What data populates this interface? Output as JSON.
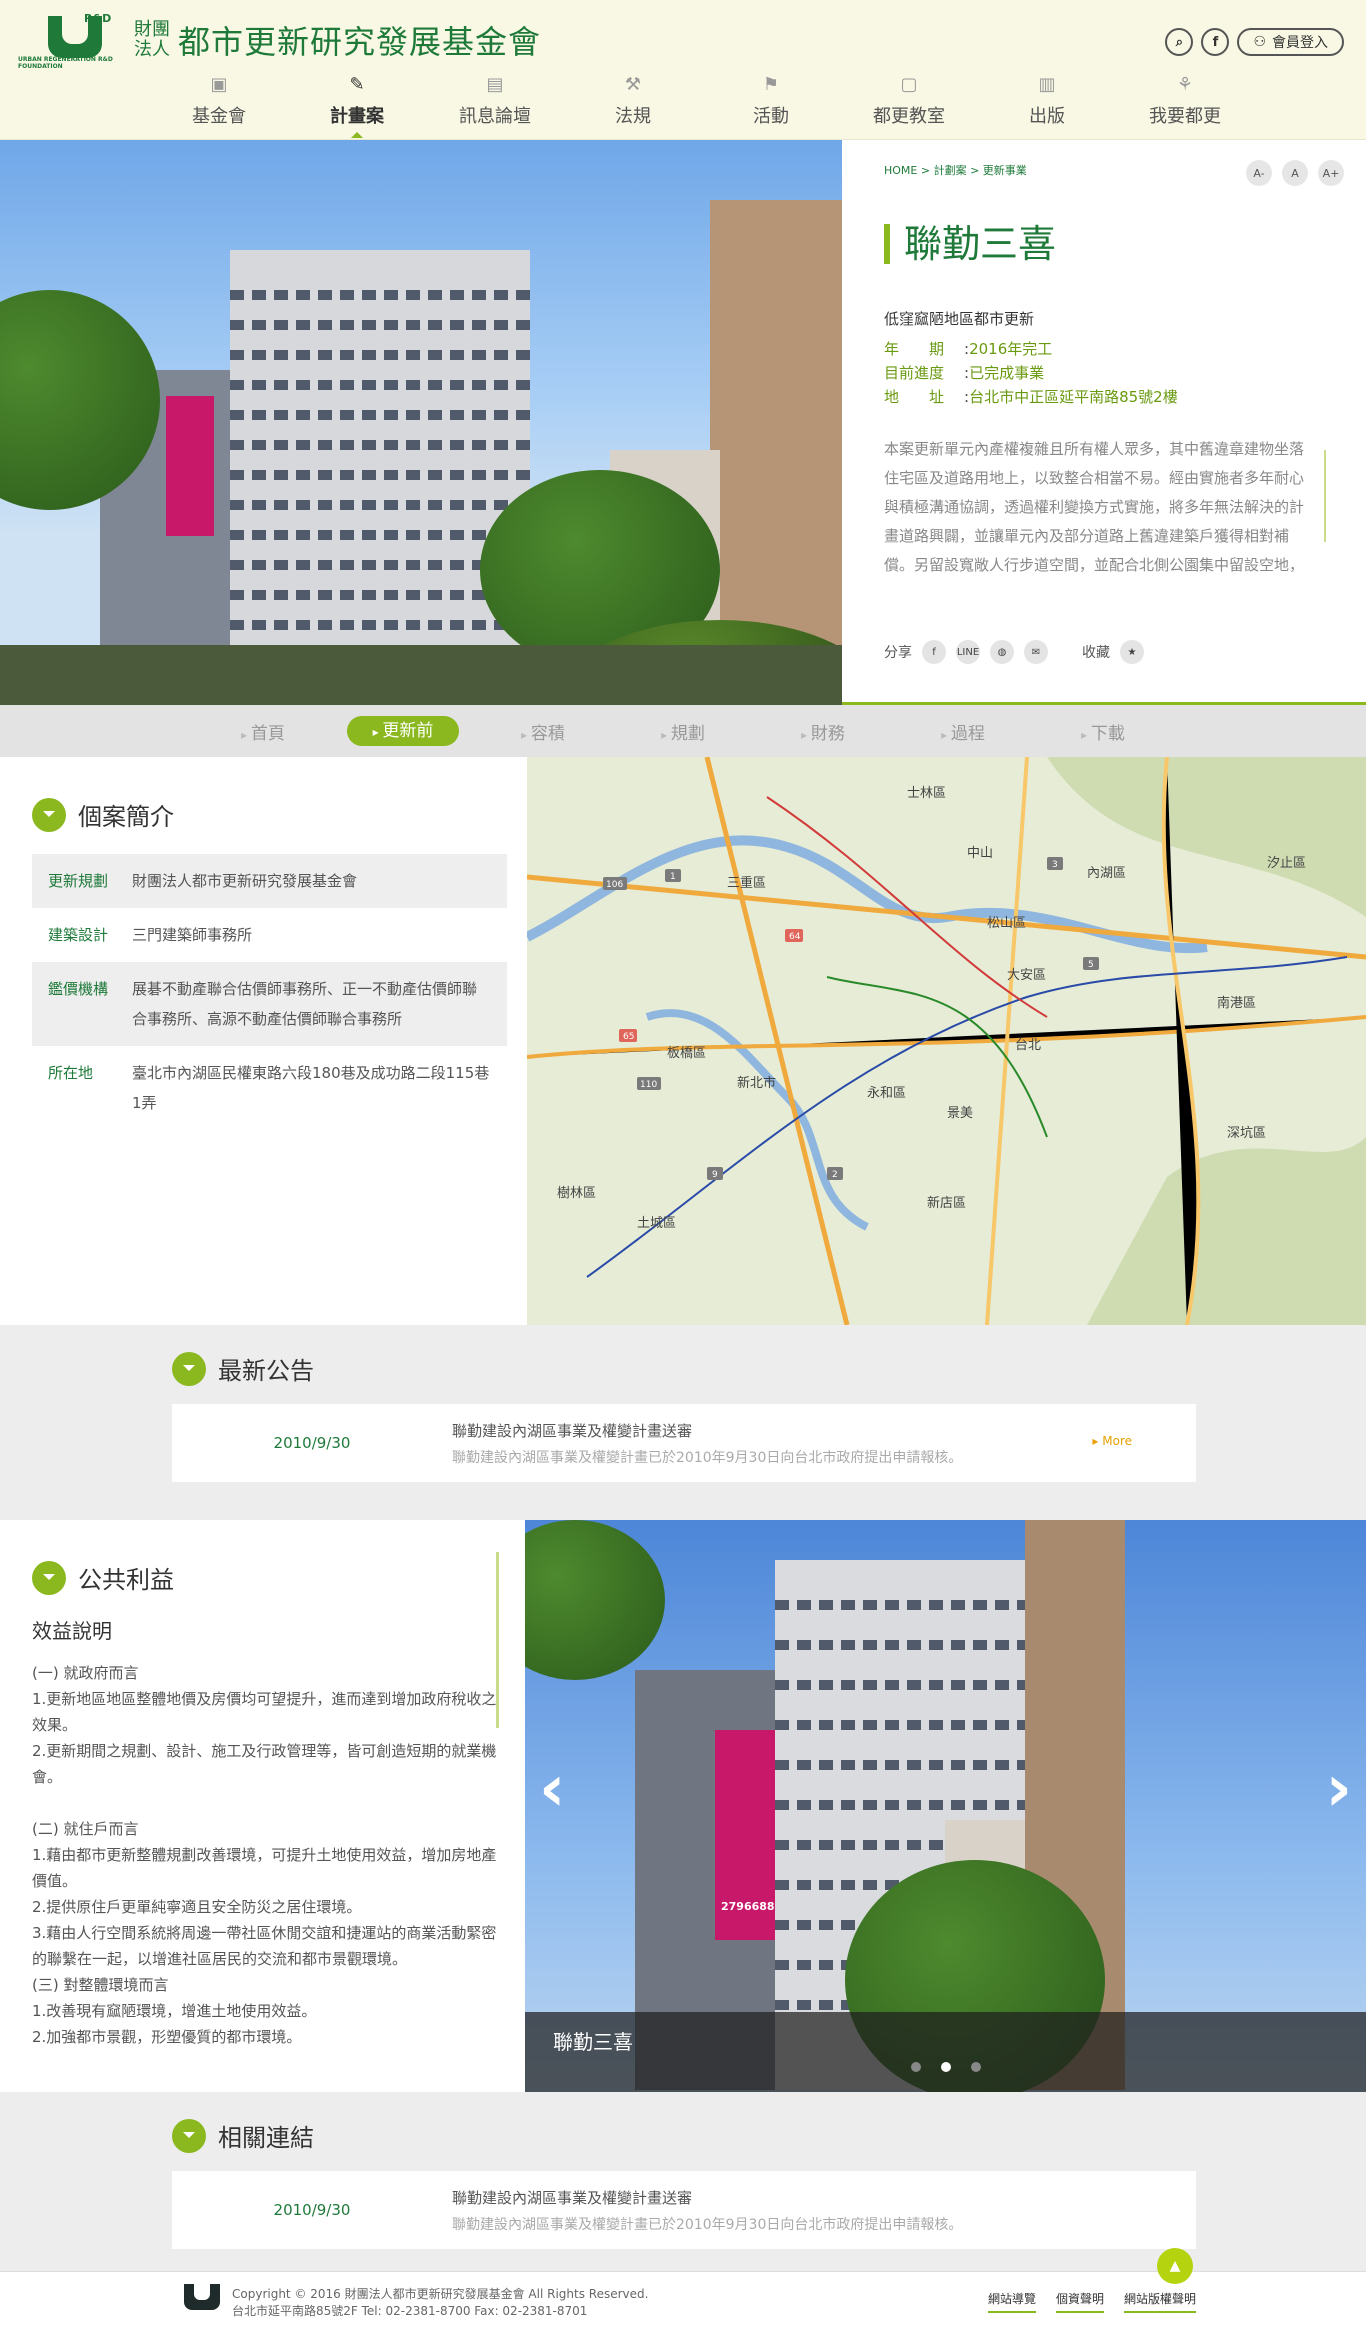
{
  "brand": {
    "small": "財團法人",
    "name": "都市更新研究發展基金會",
    "mark": "U R&D",
    "sub": "URBAN REGENERATION R&D FOUNDATION"
  },
  "tools": {
    "member_login": "會員登入"
  },
  "nav": [
    {
      "label": "基金會",
      "icon": "foundation-icon"
    },
    {
      "label": "計畫案",
      "icon": "project-icon"
    },
    {
      "label": "訊息論壇",
      "icon": "forum-icon"
    },
    {
      "label": "法規",
      "icon": "law-icon"
    },
    {
      "label": "活動",
      "icon": "event-icon"
    },
    {
      "label": "都更教室",
      "icon": "classroom-icon"
    },
    {
      "label": "出版",
      "icon": "publish-icon"
    },
    {
      "label": "我要都更",
      "icon": "renew-icon"
    }
  ],
  "breadcrumb": "HOME > 計劃案 > 更新事業",
  "font_tools": [
    "A-",
    "A",
    "A+"
  ],
  "project": {
    "title": "聯勤三喜",
    "subtitle": "低窪窳陋地區都市更新",
    "year_label": "年　　期",
    "year": "2016年完工",
    "progress_label": "目前進度",
    "progress": "已完成事業",
    "address_label": "地　　址",
    "address": "台北市中正區延平南路85號2樓",
    "description": "本案更新單元內產權複雜且所有權人眾多，其中舊違章建物坐落住宅區及道路用地上，以致整合相當不易。經由實施者多年耐心與積極溝通協調，透過權利變換方式實施，將多年無法解決的計畫道路興闢，並讓單元內及部分道路上舊違建築戶獲得相對補償。另留設寬敞人行步道空間，並配合北側公園集中留設空地，塑造成安全、舒適、"
  },
  "share": {
    "label": "分享",
    "collect": "收藏",
    "line": "LINE"
  },
  "tabs": [
    "首頁",
    "更新前",
    "容積",
    "規劃",
    "財務",
    "過程",
    "下載"
  ],
  "case": {
    "heading": "個案簡介",
    "rows": [
      {
        "k": "更新規劃",
        "v": "財團法人都市更新研究發展基金會"
      },
      {
        "k": "建築設計",
        "v": "三門建築師事務所"
      },
      {
        "k": "鑑價機構",
        "v": "展碁不動產聯合估價師事務所、正一不動產估價師聯合事務所、高源不動產估價師聯合事務所"
      },
      {
        "k": "所在地",
        "v": "臺北市內湖區民權東路六段180巷及成功路二段115巷1弄"
      }
    ]
  },
  "map": {
    "labels": [
      "台北",
      "新北市",
      "松山區",
      "中山",
      "大安區",
      "永和區",
      "新店區",
      "內湖區",
      "士林區",
      "南港區",
      "三重區",
      "板橋區",
      "土城區",
      "樹林區",
      "汐止區",
      "深坑區",
      "景美"
    ],
    "route_numbers": [
      "64",
      "1",
      "3",
      "106",
      "110",
      "65",
      "5",
      "9",
      "2"
    ]
  },
  "news": {
    "heading": "最新公告",
    "date": "2010/9/30",
    "title": "聯勤建設內湖區事業及權變計畫送審",
    "desc": "聯勤建設內湖區事業及權變計畫已於2010年9月30日向台北市政府提出申請報核。",
    "more": "More"
  },
  "public": {
    "heading": "公共利益",
    "subheading": "效益說明",
    "lines": [
      "(一) 就政府而言",
      "1.更新地區地區整體地價及房價均可望提升，進而達到增加政府稅收之效果。",
      "2.更新期間之規劃、設計、施工及行政管理等，皆可創造短期的就業機會。",
      "",
      "(二) 就住戶而言",
      "1.藉由都市更新整體規劃改善環境，可提升土地使用效益，增加房地產價值。",
      "2.提供原住戶更單純寧適且安全防災之居住環境。",
      "3.藉由人行空間系統將周邊一帶社區休閒交誼和捷運站的商業活動緊密的聯繫在一起，以增進社區居民的交流和都市景觀環境。",
      "(三) 對整體環境而言",
      "1.改善現有窳陋環境，增進土地使用效益。",
      "2.加強都市景觀，形塑優質的都市環境。"
    ],
    "slide_caption": "聯勤三喜",
    "billboard": "2796688",
    "slider_dots": 3,
    "active_dot": 2
  },
  "links": {
    "heading": "相關連結",
    "date": "2010/9/30",
    "title": "聯勤建設內湖區事業及權變計畫送審",
    "desc": "聯勤建設內湖區事業及權變計畫已於2010年9月30日向台北市政府提出申請報核。"
  },
  "footer": {
    "copyright": "Copyright © 2016 財團法人都市更新研究發展基金會 All Rights Reserved.",
    "address": "台北市延平南路85號2F Tel: 02-2381-8700  Fax: 02-2381-8701",
    "links": [
      "網站導覽",
      "個資聲明",
      "網站版權聲明"
    ]
  },
  "colors": {
    "brand_green": "#1f7a3a",
    "accent_lime": "#8ab81e",
    "header_bg": "#f8f8e4"
  }
}
